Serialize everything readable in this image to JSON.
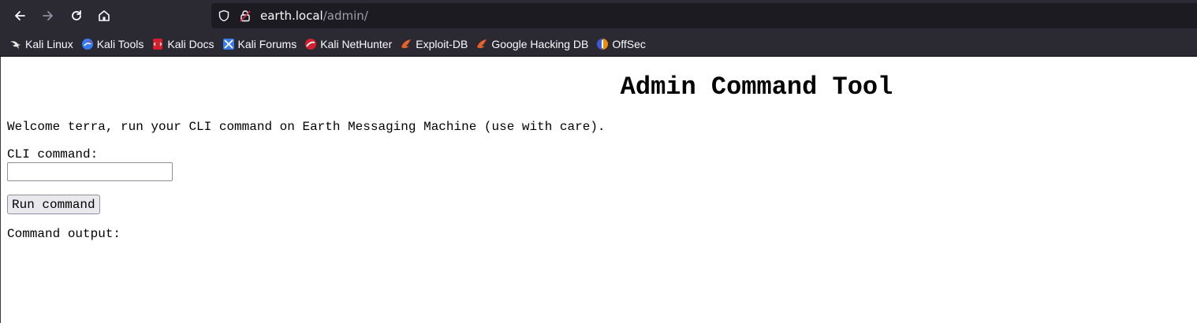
{
  "browser": {
    "url_host": "earth.local",
    "url_path": "/admin/",
    "bookmarks": [
      {
        "label": "Kali Linux",
        "icon": "kali-dragon-icon"
      },
      {
        "label": "Kali Tools",
        "icon": "kali-tools-icon"
      },
      {
        "label": "Kali Docs",
        "icon": "kali-docs-icon"
      },
      {
        "label": "Kali Forums",
        "icon": "kali-forums-icon"
      },
      {
        "label": "Kali NetHunter",
        "icon": "kali-nethunter-icon"
      },
      {
        "label": "Exploit-DB",
        "icon": "exploit-db-icon"
      },
      {
        "label": "Google Hacking DB",
        "icon": "google-hacking-db-icon"
      },
      {
        "label": "OffSec",
        "icon": "offsec-icon"
      }
    ]
  },
  "page": {
    "title": "Admin Command Tool",
    "welcome": "Welcome terra, run your CLI command on Earth Messaging Machine (use with care).",
    "cli_label": "CLI command:",
    "cli_value": "",
    "run_button": "Run command",
    "output_label": "Command output:"
  }
}
